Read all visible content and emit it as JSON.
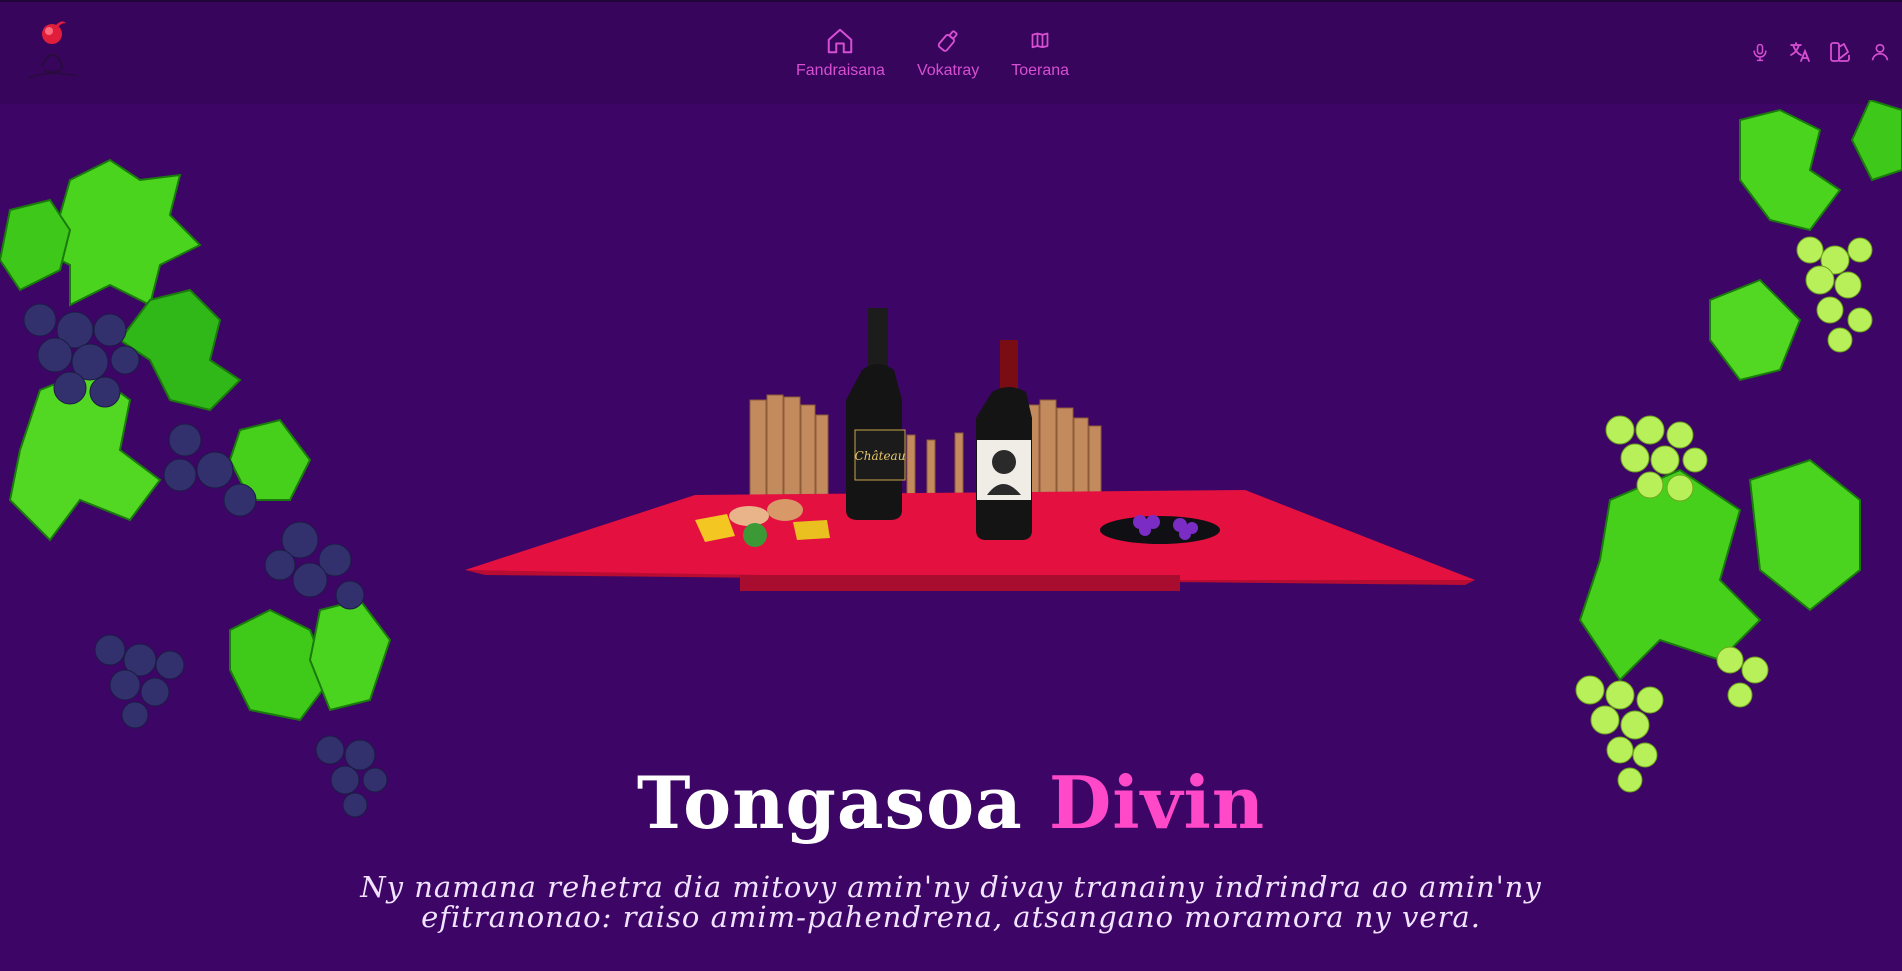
{
  "nav": {
    "items": [
      {
        "label": "Fandraisana",
        "icon": "home-icon"
      },
      {
        "label": "Vokatray",
        "icon": "bottle-icon"
      },
      {
        "label": "Toerana",
        "icon": "map-icon"
      }
    ]
  },
  "header_icons": [
    "microphone-icon",
    "translate-icon",
    "theme-icon",
    "user-icon"
  ],
  "hero": {
    "title_part1": "Tongasoa",
    "title_part2": "Divin",
    "subtitle": "Ny namana rehetra dia mitovy amin'ny divay tranainy indrindra ao amin'ny efitranonao: raiso amim-pahendrena, atsangano moramora ny vera."
  },
  "colors": {
    "background": "#3d0565",
    "header": "#38055d",
    "accent": "#d64fd2",
    "title_accent": "#ff49c9",
    "tablecloth": "#e4103f"
  }
}
